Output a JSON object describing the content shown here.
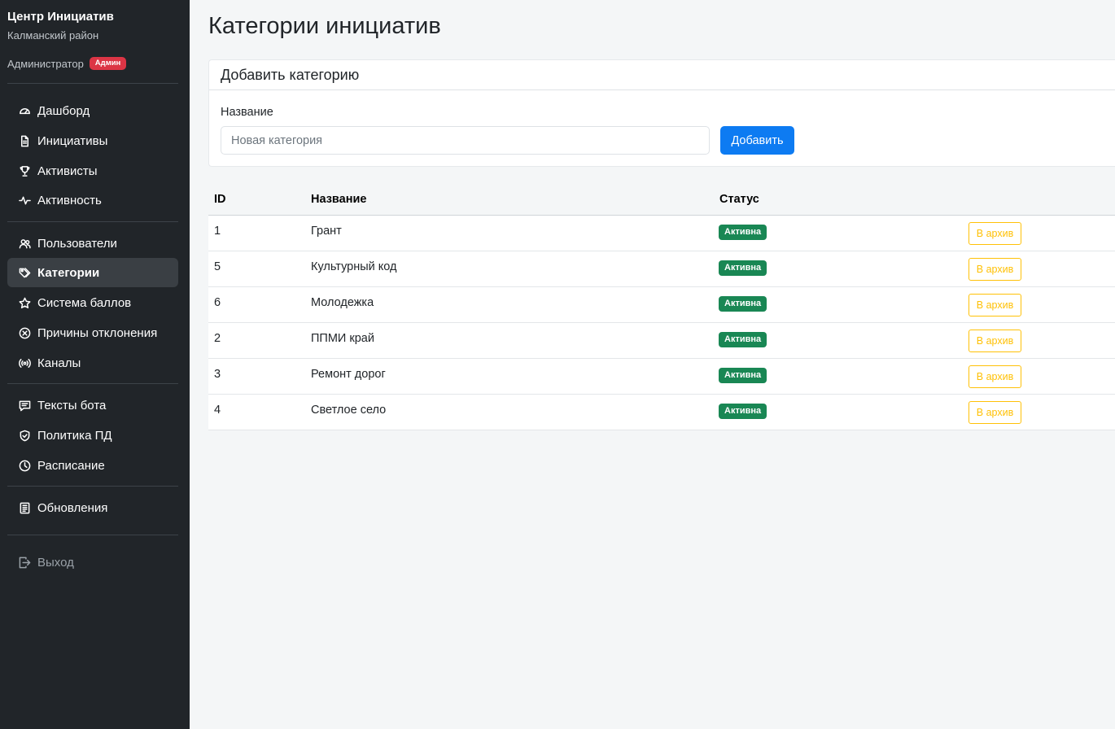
{
  "sidebar": {
    "brand_title": "Центр Инициатив",
    "brand_subtitle": "Калманский район",
    "user_name": "Администратор",
    "role_badge": "Админ",
    "items": [
      {
        "label": "Дашборд",
        "icon": "dashboard-icon"
      },
      {
        "label": "Инициативы",
        "icon": "document-icon"
      },
      {
        "label": "Активисты",
        "icon": "trophy-icon"
      },
      {
        "label": "Активность",
        "icon": "activity-icon"
      },
      {
        "label": "Пользователи",
        "icon": "users-icon"
      },
      {
        "label": "Категории",
        "icon": "tags-icon",
        "active": true
      },
      {
        "label": "Система баллов",
        "icon": "star-icon"
      },
      {
        "label": "Причины отклонения",
        "icon": "x-circle-icon"
      },
      {
        "label": "Каналы",
        "icon": "broadcast-icon"
      },
      {
        "label": "Тексты бота",
        "icon": "chat-text-icon"
      },
      {
        "label": "Политика ПД",
        "icon": "shield-check-icon"
      },
      {
        "label": "Расписание",
        "icon": "clock-icon"
      },
      {
        "label": "Обновления",
        "icon": "journal-icon"
      },
      {
        "label": "Выход",
        "icon": "logout-icon"
      }
    ]
  },
  "page": {
    "title": "Категории инициатив"
  },
  "add_form": {
    "title": "Добавить категорию",
    "field_label": "Название",
    "placeholder": "Новая категория",
    "value": "",
    "submit_label": "Добавить"
  },
  "table": {
    "headers": {
      "id": "ID",
      "name": "Название",
      "status": "Статус"
    },
    "rows": [
      {
        "id": "1",
        "name": "Грант",
        "status": "Активна",
        "action": "В архив"
      },
      {
        "id": "5",
        "name": "Культурный код",
        "status": "Активна",
        "action": "В архив"
      },
      {
        "id": "6",
        "name": "Молодежка",
        "status": "Активна",
        "action": "В архив"
      },
      {
        "id": "2",
        "name": "ППМИ край",
        "status": "Активна",
        "action": "В архив"
      },
      {
        "id": "3",
        "name": "Ремонт дорог",
        "status": "Активна",
        "action": "В архив"
      },
      {
        "id": "4",
        "name": "Светлое село",
        "status": "Активна",
        "action": "В архив"
      }
    ]
  },
  "colors": {
    "sidebar_bg": "#212529",
    "primary": "#0d7bf2",
    "success": "#198754",
    "warning": "#ffc107",
    "danger": "#dc3545"
  }
}
